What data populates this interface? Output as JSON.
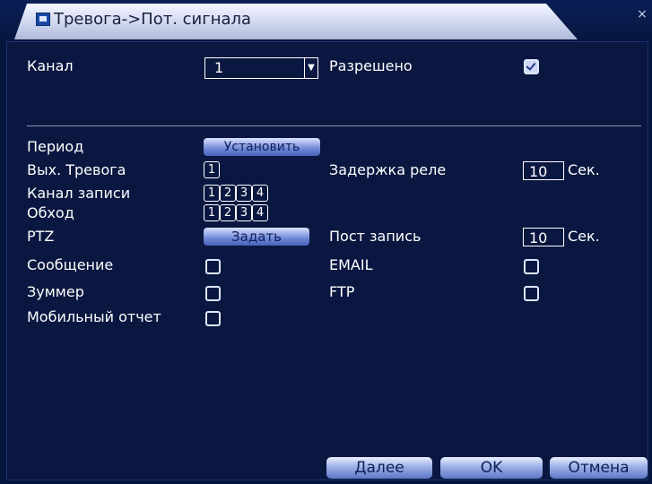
{
  "window": {
    "title": "Тревога->Пот. сигнала",
    "close_glyph": "×"
  },
  "channel": {
    "label": "Канал",
    "value": "1",
    "enabled_label": "Разрешено",
    "enabled": true
  },
  "period": {
    "label": "Период",
    "button": "Установить"
  },
  "alarm_out": {
    "label": "Вых. Тревога",
    "channels": [
      "1"
    ]
  },
  "relay_delay": {
    "label": "Задержка реле",
    "value": "10",
    "unit": "Сек."
  },
  "record_channel": {
    "label": "Канал записи",
    "channels": [
      "1",
      "2",
      "3",
      "4"
    ]
  },
  "tour": {
    "label": "Обход",
    "channels": [
      "1",
      "2",
      "3",
      "4"
    ]
  },
  "ptz": {
    "label": "PTZ",
    "button": "Задать"
  },
  "post_record": {
    "label": "Пост запись",
    "value": "10",
    "unit": "Сек."
  },
  "message": {
    "label": "Сообщение",
    "checked": false
  },
  "email": {
    "label": "EMAIL",
    "checked": false
  },
  "buzzer": {
    "label": "Зуммер",
    "checked": false
  },
  "ftp": {
    "label": "FTP",
    "checked": false
  },
  "mobile_report": {
    "label": "Мобильный отчет",
    "checked": false
  },
  "buttons": {
    "advanced": "Далее",
    "ok": "OK",
    "cancel": "Отмена"
  }
}
